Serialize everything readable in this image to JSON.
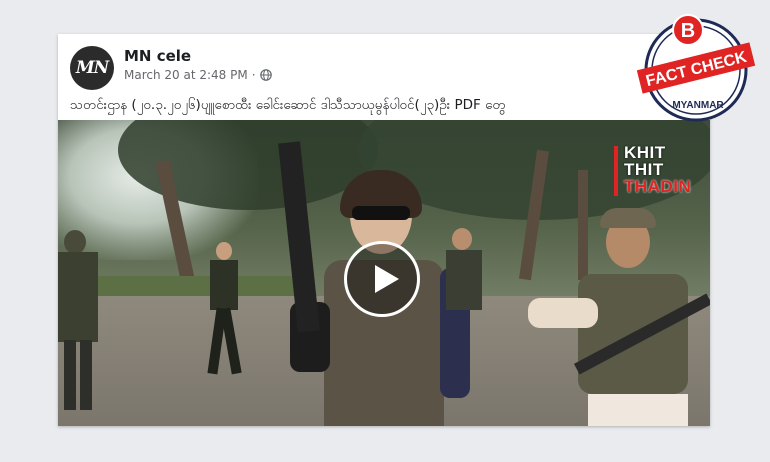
{
  "post": {
    "author": "MN cele",
    "avatar_text": "MN",
    "timestamp": "March 20 at 2:48 PM",
    "separator": "·",
    "privacy_icon": "globe-icon",
    "text": "သတင်းဌာန (၂၀.၃.၂၀၂၆)ပျူစောထီး ခေါင်းဆောင် ဒါသီသာယုမွန်ပါဝင်(၂၃)ဦး PDF တွေ"
  },
  "video": {
    "play_icon": "play-icon",
    "watermark": {
      "line1": "KHIT",
      "line2": "THIT",
      "line3": "THADIN"
    }
  },
  "badge": {
    "letter": "B",
    "label": "FACT CHECK",
    "country": "MYANMAR"
  },
  "colors": {
    "badge_red": "#e02424",
    "badge_navy": "#1f2a56",
    "text_primary": "#1c1e21",
    "text_secondary": "#65676b"
  }
}
